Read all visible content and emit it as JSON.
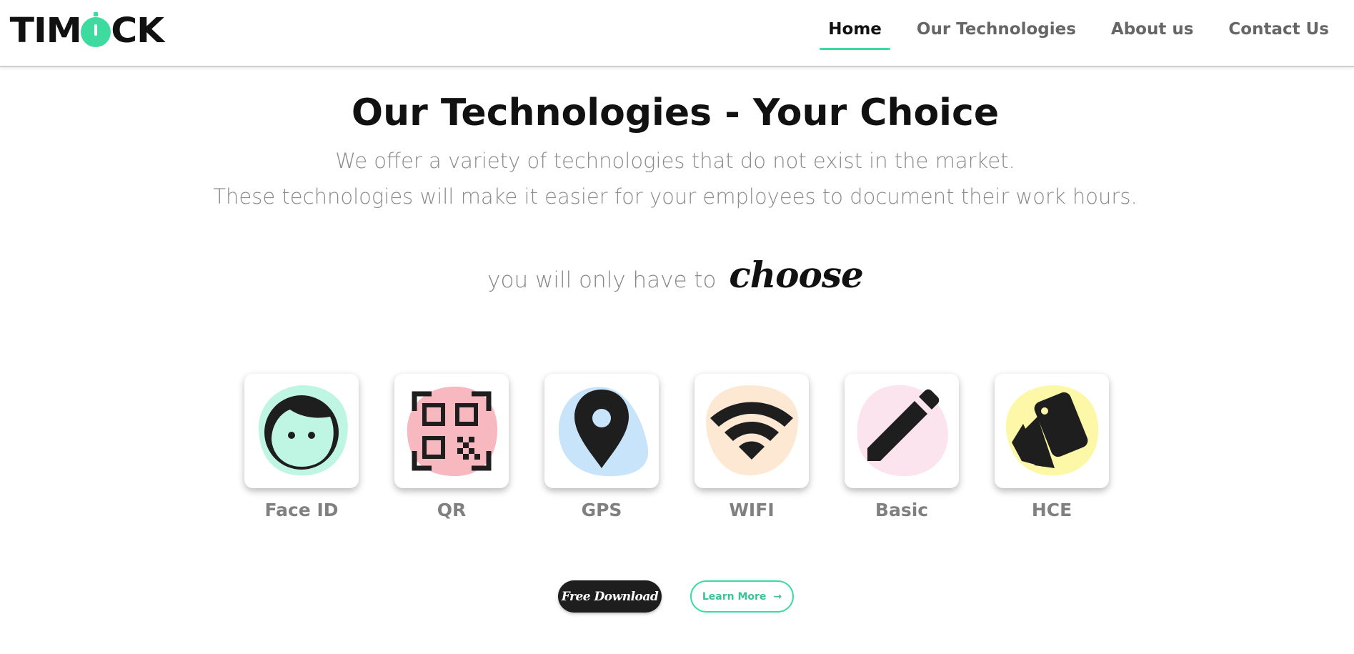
{
  "brand": {
    "logo_text_before": "TIM",
    "logo_text_after": "CK",
    "accent_color": "#3ddba0"
  },
  "nav": {
    "items": [
      {
        "label": "Home",
        "active": true
      },
      {
        "label": "Our Technologies",
        "active": false
      },
      {
        "label": "About us",
        "active": false
      },
      {
        "label": "Contact Us",
        "active": false
      }
    ]
  },
  "hero": {
    "title": "Our Technologies - Your Choice",
    "subtitle_line1": "We offer a variety of technologies that do not exist in the market.",
    "subtitle_line2": "These technologies will make it easier for your employees to document their work hours.",
    "choose_prefix": "you will only have to",
    "choose_word": "choose"
  },
  "technologies": [
    {
      "label": "Face ID",
      "icon": "face-icon",
      "blob_color": "#bff5e3"
    },
    {
      "label": "QR",
      "icon": "qr-code-icon",
      "blob_color": "#f7b8c0"
    },
    {
      "label": "GPS",
      "icon": "location-pin-icon",
      "blob_color": "#c7e4fb"
    },
    {
      "label": "WIFI",
      "icon": "wifi-icon",
      "blob_color": "#fde9d3"
    },
    {
      "label": "Basic",
      "icon": "pencil-icon",
      "blob_color": "#fce4ee"
    },
    {
      "label": "HCE",
      "icon": "cards-icon",
      "blob_color": "#fdf7a8"
    }
  ],
  "buttons": {
    "download_label": "Free Download",
    "learn_more_label": "Learn More",
    "learn_more_icon": "arrow-right-icon"
  }
}
